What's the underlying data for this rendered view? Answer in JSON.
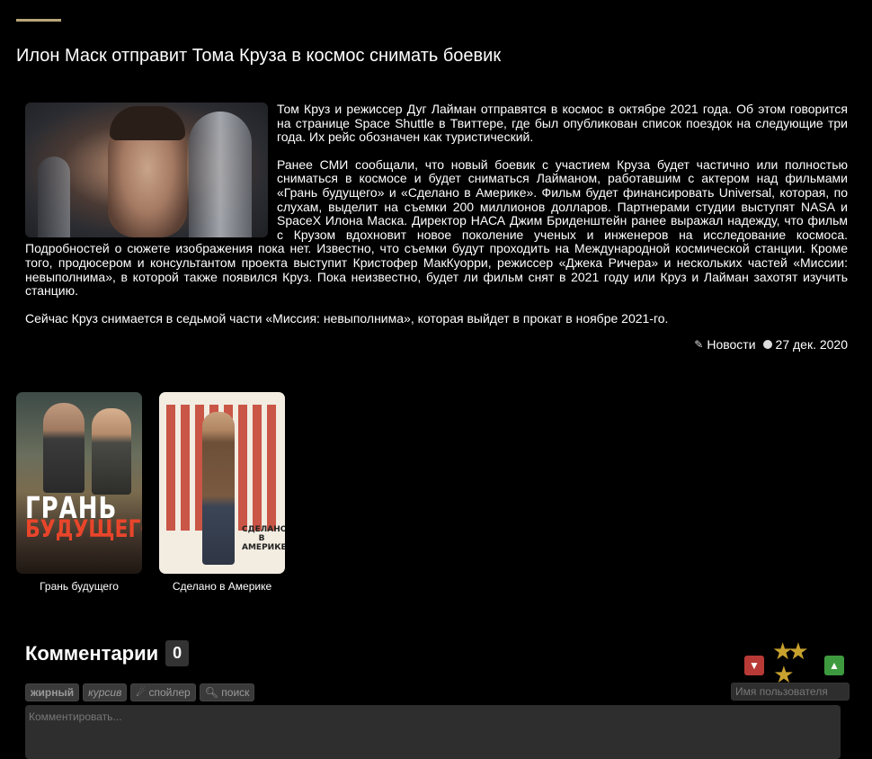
{
  "article": {
    "title": "Илон Маск отправит Тома Круза в космос снимать боевик",
    "paragraphs": [
      "Том Круз и режиссер Дуг Лайман отправятся в космос в октябре 2021 года. Об этом говорится на странице Space Shuttle в Твиттере, где был опубликован список поездок на следующие три года. Их рейс обозначен как туристический.",
      "Ранее СМИ сообщали, что новый боевик с участием Круза будет частично или полностью сниматься в космосе и будет сниматься Лайманом, работавшим с актером над фильмами «Грань будущего» и «Сделано в Америке». Фильм будет финансировать Universal, которая, по слухам, выделит на съемки 200 миллионов долларов. Партнерами студии выступят NASA и SpaceX Илона Маска. Директор НАСА Джим Бриденштейн ранее выражал надежду, что фильм с Крузом вдохновит новое поколение ученых и инженеров на исследование космоса. Подробностей о сюжете изображения пока нет. Известно, что съемки будут проходить на Международной космической станции. Кроме того, продюсером и консультантом проекта выступит Кристофер МакКуорри, режиссер «Джека Ричера» и нескольких частей «Миссии: невыполнима», в которой также появился Круз. Пока неизвестно, будет ли фильм снят в 2021 году или Круз и Лайман захотят изучить станцию.",
      "Сейчас Круз снимается в седьмой части «Миссия: невыполнима», которая выйдет в прокат в ноябре 2021-го."
    ],
    "category": "Новости",
    "date": "27 дек. 2020",
    "category_icon": "pencil-icon",
    "date_icon": "clock-icon"
  },
  "related_movies": [
    {
      "title": "Грань будущего",
      "poster_text_line1": "ГРАНЬ",
      "poster_text_line2": "БУДУЩЕГО"
    },
    {
      "title": "Сделано в Америке",
      "poster_text": "СДЕЛАНО В АМЕРИКЕ"
    }
  ],
  "comments": {
    "heading": "Комментарии",
    "count": "0",
    "toolbar": {
      "bold": "жирный",
      "italic": "курсив",
      "spoiler": "спойлер",
      "search": "поиск"
    },
    "username_placeholder": "Имя пользователя",
    "comment_placeholder": "Комментировать..."
  },
  "colors": {
    "accent": "#b8a67a",
    "background": "#000000",
    "star": "#c8a12e",
    "dislike": "#b83a36",
    "like": "#3e9a3f"
  }
}
